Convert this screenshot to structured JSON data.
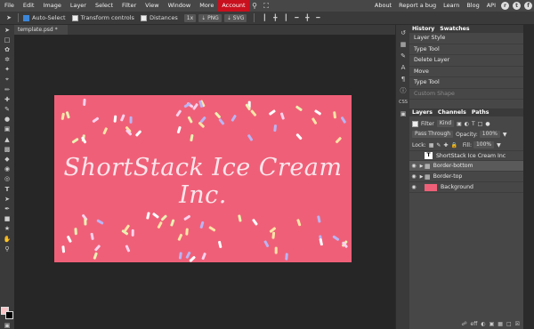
{
  "menu": {
    "items": [
      "File",
      "Edit",
      "Image",
      "Layer",
      "Select",
      "Filter",
      "View",
      "Window",
      "More"
    ],
    "account": "Account",
    "right": [
      "About",
      "Report a bug",
      "Learn",
      "Blog",
      "API"
    ]
  },
  "options": {
    "auto_select": "Auto-Select",
    "transform_controls": "Transform controls",
    "distances": "Distances",
    "zoom": "1x",
    "png": "PNG",
    "svg": "SVG"
  },
  "document_tab": "template.psd *",
  "artboard": {
    "headline": "ShortStack Ice Cream Inc.",
    "background_color": "#ef6078",
    "sprinkle_colors": [
      "#fde5a6",
      "#b9b5f5",
      "#e9f2b2",
      "#fbd2ee",
      "#ffffff"
    ]
  },
  "history": {
    "tabs": [
      "History",
      "Swatches"
    ],
    "items": [
      "Layer Style",
      "Type Tool",
      "Delete Layer",
      "Move",
      "Type Tool",
      "Custom Shape"
    ]
  },
  "layers_panel": {
    "tabs": [
      "Layers",
      "Channels",
      "Paths"
    ],
    "filter": "Filter",
    "kind": "Kind",
    "blend_mode": "Pass Through",
    "opacity_label": "Opacity:",
    "opacity_value": "100%",
    "lock_label": "Lock:",
    "fill_label": "Fill:",
    "fill_value": "100%",
    "layers": [
      {
        "name": "ShortStack Ice Cream Inc",
        "type": "text"
      },
      {
        "name": "Border-bottom",
        "type": "folder",
        "selected": true
      },
      {
        "name": "Border-top",
        "type": "folder"
      },
      {
        "name": "Background",
        "type": "image"
      }
    ]
  }
}
